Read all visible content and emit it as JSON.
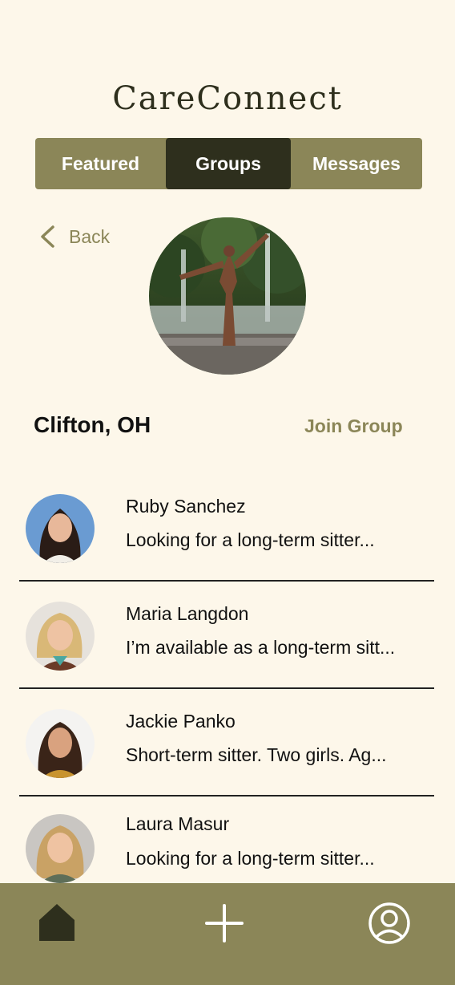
{
  "app": {
    "title": "CareConnect"
  },
  "tabs": [
    {
      "label": "Featured"
    },
    {
      "label": "Groups",
      "active": true
    },
    {
      "label": "Messages"
    }
  ],
  "back": {
    "label": "Back",
    "icon": "chevron-left-icon"
  },
  "group": {
    "name": "Clifton, OH",
    "join_label": "Join Group"
  },
  "members": [
    {
      "name": "Ruby Sanchez",
      "preview": "Looking for a long-term sitter..."
    },
    {
      "name": "Maria Langdon",
      "preview": "I’m available as a long-term sitt..."
    },
    {
      "name": "Jackie Panko",
      "preview": "Short-term sitter. Two girls. Ag..."
    },
    {
      "name": "Laura Masur",
      "preview": "Looking for a long-term sitter..."
    }
  ],
  "bottom_nav": [
    {
      "icon": "home-icon"
    },
    {
      "icon": "plus-icon"
    },
    {
      "icon": "profile-icon"
    }
  ],
  "colors": {
    "background": "#fdf7ea",
    "accent": "#8b8658",
    "dark": "#2e2f1d"
  }
}
